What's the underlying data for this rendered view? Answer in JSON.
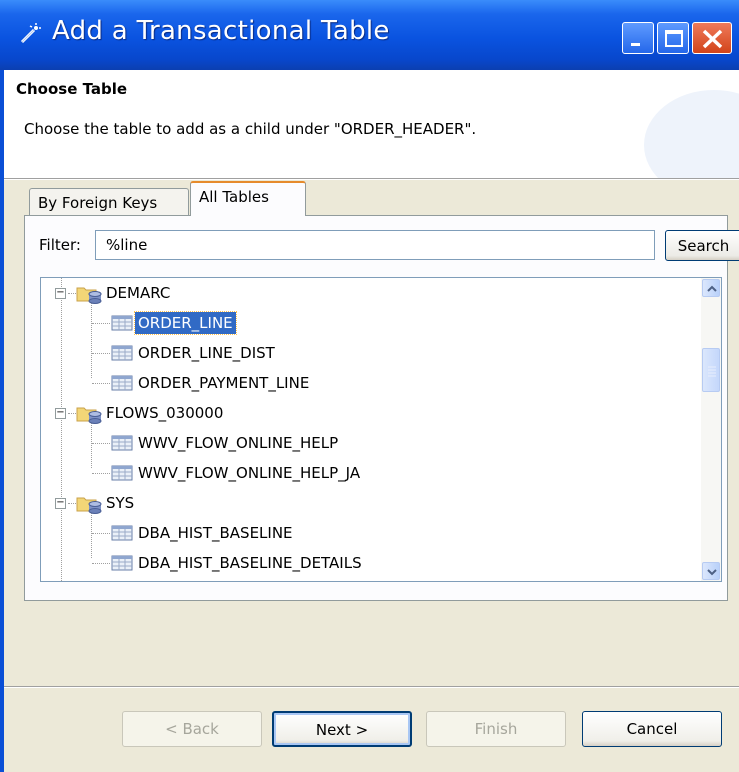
{
  "window": {
    "title": "Add a Transactional Table"
  },
  "header": {
    "title": "Choose Table",
    "description": "Choose the table to add as a child under \"ORDER_HEADER\"."
  },
  "tabs": [
    {
      "label": "By Foreign Keys",
      "selected": false
    },
    {
      "label": "All Tables",
      "selected": true
    }
  ],
  "filter": {
    "label": "Filter:",
    "value": "%line",
    "search_label": "Search"
  },
  "tree": {
    "schemas": [
      {
        "name": "DEMARC",
        "expanded": true,
        "tables": [
          "ORDER_LINE",
          "ORDER_LINE_DIST",
          "ORDER_PAYMENT_LINE"
        ]
      },
      {
        "name": "FLOWS_030000",
        "expanded": true,
        "tables": [
          "WWV_FLOW_ONLINE_HELP",
          "WWV_FLOW_ONLINE_HELP_JA"
        ]
      },
      {
        "name": "SYS",
        "expanded": true,
        "tables": [
          "DBA_HIST_BASELINE",
          "DBA_HIST_BASELINE_DETAILS"
        ]
      }
    ],
    "selected": "ORDER_LINE"
  },
  "buttons": {
    "back": "< Back",
    "next": "Next >",
    "finish": "Finish",
    "cancel": "Cancel"
  },
  "colors": {
    "titlebar": "#0a53e0",
    "selection": "#316ac5",
    "dialog_bg": "#ece9d8"
  }
}
